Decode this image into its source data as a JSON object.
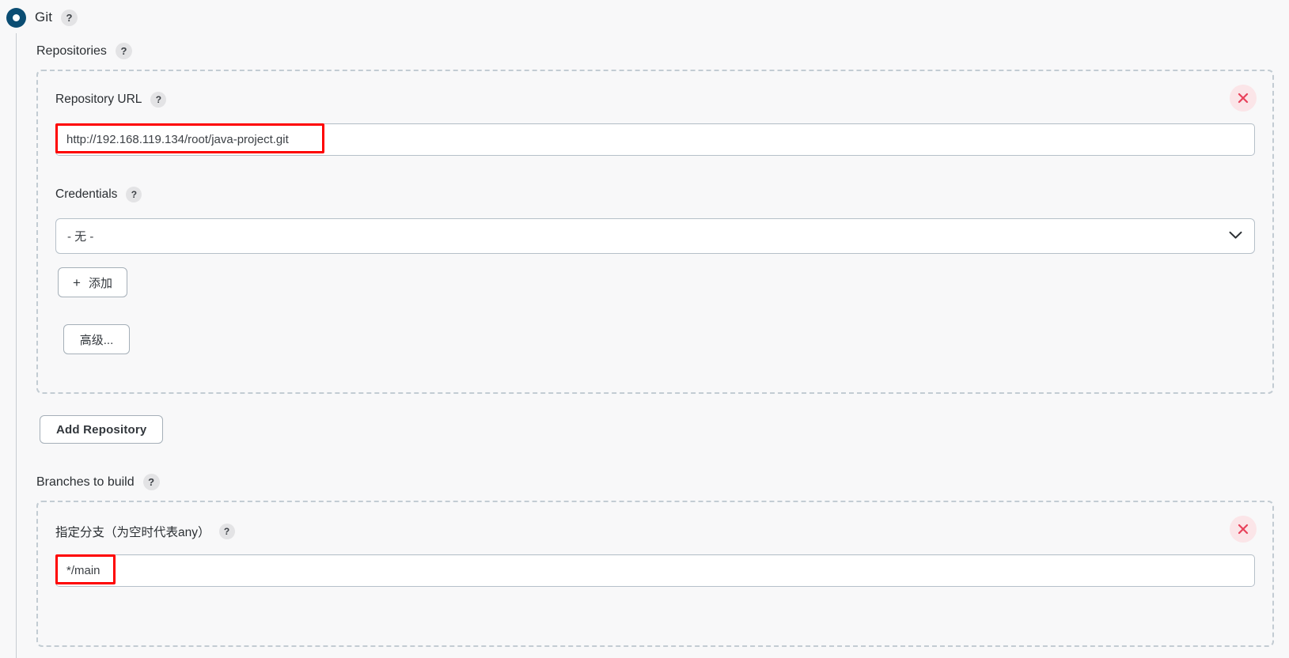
{
  "scm": {
    "label": "Git",
    "help": "?",
    "selected": true
  },
  "repositories": {
    "label": "Repositories",
    "help": "?",
    "add_repository_label": "Add Repository",
    "entry": {
      "url_label": "Repository URL",
      "url_help": "?",
      "url_value": "http://192.168.119.134/root/java-project.git",
      "credentials_label": "Credentials",
      "credentials_help": "?",
      "credentials_value": "- 无 -",
      "add_credentials_label": "添加",
      "add_credentials_plus": "+",
      "advanced_label": "高级...",
      "delete_icon": "close-icon"
    }
  },
  "branches": {
    "label": "Branches to build",
    "help": "?",
    "entry": {
      "spec_label": "指定分支（为空时代表any）",
      "spec_help": "?",
      "spec_value": "*/main",
      "delete_icon": "close-icon"
    }
  },
  "colors": {
    "radio_accent": "#0b4d73",
    "dashed_border": "#c3ccd3",
    "annotation_red": "#fe0000",
    "delete_bg": "#fbe5e8",
    "delete_fg": "#e8425b",
    "page_bg": "#f8f8f9"
  }
}
